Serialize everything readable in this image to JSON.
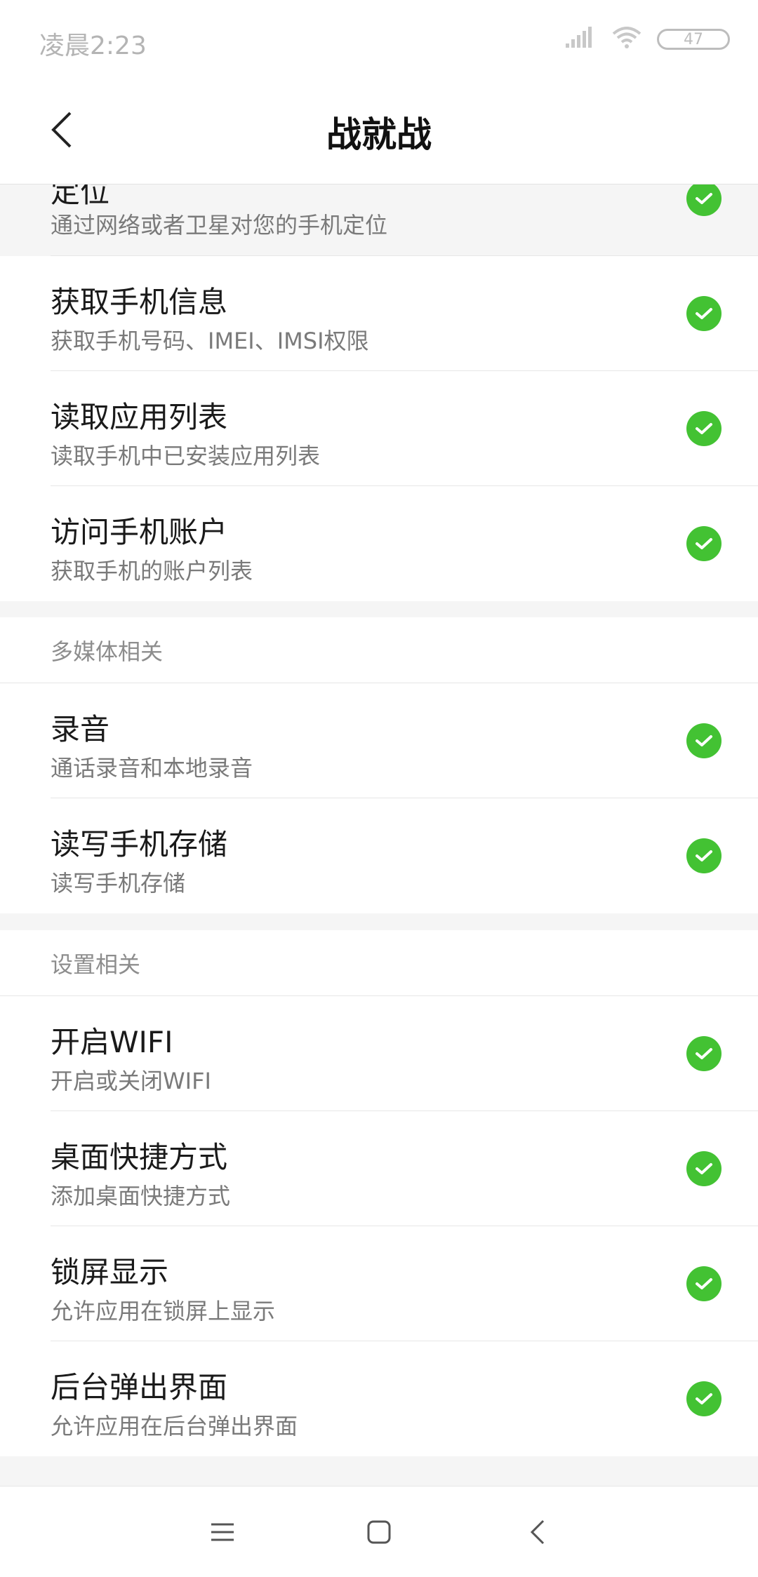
{
  "status_bar": {
    "time": "凌晨2:23",
    "battery": "47",
    "icons": [
      "signal-icon",
      "wifi-icon",
      "battery-icon"
    ]
  },
  "header": {
    "title": "战就战",
    "back_icon": "back-arrow-icon"
  },
  "sections": [
    {
      "header": "",
      "items": [
        {
          "title": "定位",
          "subtitle": "通过网络或者卫星对您的手机定位",
          "checked": true
        },
        {
          "title": "获取手机信息",
          "subtitle": "获取手机号码、IMEI、IMSI权限",
          "checked": true
        },
        {
          "title": "读取应用列表",
          "subtitle": "读取手机中已安装应用列表",
          "checked": true
        },
        {
          "title": "访问手机账户",
          "subtitle": "获取手机的账户列表",
          "checked": true
        }
      ]
    },
    {
      "header": "多媒体相关",
      "items": [
        {
          "title": "录音",
          "subtitle": "通话录音和本地录音",
          "checked": true
        },
        {
          "title": "读写手机存储",
          "subtitle": "读写手机存储",
          "checked": true
        }
      ]
    },
    {
      "header": "设置相关",
      "items": [
        {
          "title": "开启WIFI",
          "subtitle": "开启或关闭WIFI",
          "checked": true
        },
        {
          "title": "桌面快捷方式",
          "subtitle": "添加桌面快捷方式",
          "checked": true
        },
        {
          "title": "锁屏显示",
          "subtitle": "允许应用在锁屏上显示",
          "checked": true
        },
        {
          "title": "后台弹出界面",
          "subtitle": "允许应用在后台弹出界面",
          "checked": true
        }
      ]
    }
  ],
  "nav_bar": {
    "icons": [
      "menu-icon",
      "home-icon",
      "back-icon"
    ]
  },
  "colors": {
    "check_green": "#43c233",
    "section_gray": "#f5f5f5"
  }
}
